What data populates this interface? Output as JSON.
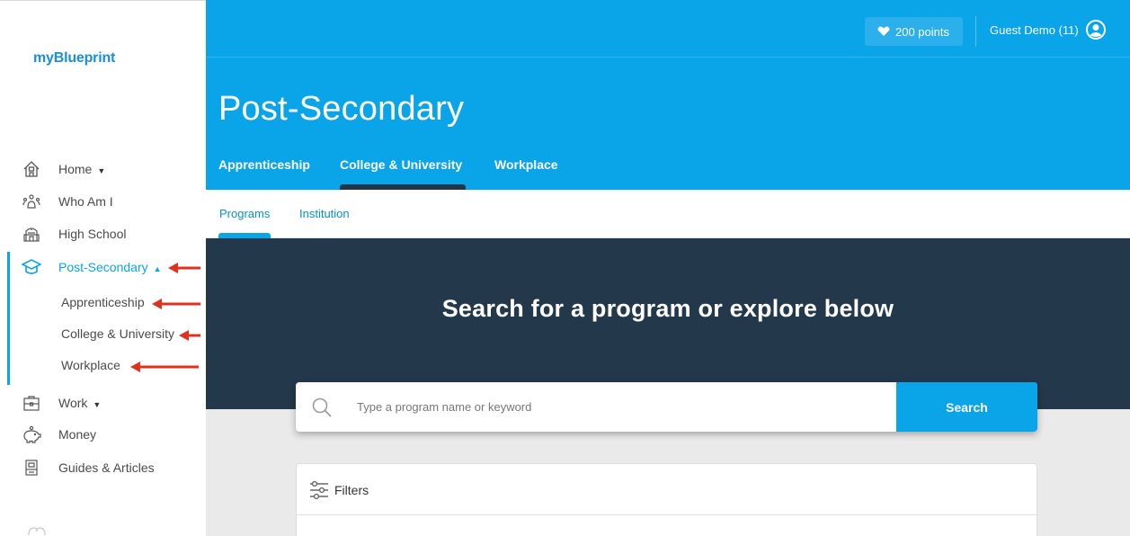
{
  "app": {
    "brand": "myBlueprint"
  },
  "sidebar": {
    "items": [
      {
        "label": "Home",
        "icon": "home-icon",
        "has_caret": true
      },
      {
        "label": "Who Am I",
        "icon": "people-icon",
        "has_caret": false
      },
      {
        "label": "High School",
        "icon": "school-building-icon",
        "has_caret": false
      },
      {
        "label": "Post-Secondary",
        "icon": "graduation-cap-icon",
        "has_caret": true,
        "active": true
      },
      {
        "label": "Work",
        "icon": "briefcase-icon",
        "has_caret": true
      },
      {
        "label": "Money",
        "icon": "piggy-bank-icon",
        "has_caret": false
      },
      {
        "label": "Guides & Articles",
        "icon": "book-icon",
        "has_caret": false
      }
    ],
    "subitems": [
      {
        "label": "Apprenticeship"
      },
      {
        "label": "College & University"
      },
      {
        "label": "Workplace"
      }
    ]
  },
  "header": {
    "points_label": "200 points",
    "user_label": "Guest Demo (11)",
    "title": "Post-Secondary",
    "tabs": [
      {
        "label": "Apprenticeship"
      },
      {
        "label": "College & University",
        "active": true
      },
      {
        "label": "Workplace"
      }
    ]
  },
  "subnav": {
    "tabs": [
      {
        "label": "Programs",
        "active": true
      },
      {
        "label": "Institution"
      }
    ]
  },
  "hero": {
    "title": "Search for a program or explore below"
  },
  "search": {
    "placeholder": "Type a program name or keyword",
    "button_label": "Search"
  },
  "filters": {
    "label": "Filters"
  },
  "colors": {
    "brand_blue": "#0aa4e8",
    "hero_navy": "#23384b",
    "annotation_red": "#e0301e"
  }
}
